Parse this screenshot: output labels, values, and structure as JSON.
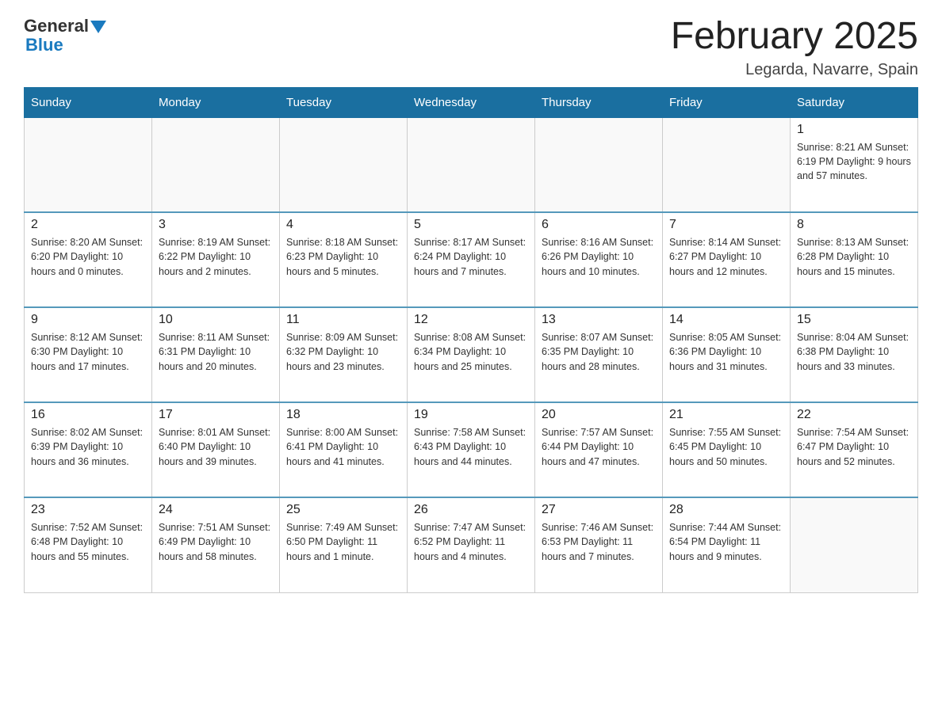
{
  "header": {
    "logo_general": "General",
    "logo_blue": "Blue",
    "title": "February 2025",
    "location": "Legarda, Navarre, Spain"
  },
  "weekdays": [
    "Sunday",
    "Monday",
    "Tuesday",
    "Wednesday",
    "Thursday",
    "Friday",
    "Saturday"
  ],
  "weeks": [
    [
      {
        "day": "",
        "info": ""
      },
      {
        "day": "",
        "info": ""
      },
      {
        "day": "",
        "info": ""
      },
      {
        "day": "",
        "info": ""
      },
      {
        "day": "",
        "info": ""
      },
      {
        "day": "",
        "info": ""
      },
      {
        "day": "1",
        "info": "Sunrise: 8:21 AM\nSunset: 6:19 PM\nDaylight: 9 hours and 57 minutes."
      }
    ],
    [
      {
        "day": "2",
        "info": "Sunrise: 8:20 AM\nSunset: 6:20 PM\nDaylight: 10 hours and 0 minutes."
      },
      {
        "day": "3",
        "info": "Sunrise: 8:19 AM\nSunset: 6:22 PM\nDaylight: 10 hours and 2 minutes."
      },
      {
        "day": "4",
        "info": "Sunrise: 8:18 AM\nSunset: 6:23 PM\nDaylight: 10 hours and 5 minutes."
      },
      {
        "day": "5",
        "info": "Sunrise: 8:17 AM\nSunset: 6:24 PM\nDaylight: 10 hours and 7 minutes."
      },
      {
        "day": "6",
        "info": "Sunrise: 8:16 AM\nSunset: 6:26 PM\nDaylight: 10 hours and 10 minutes."
      },
      {
        "day": "7",
        "info": "Sunrise: 8:14 AM\nSunset: 6:27 PM\nDaylight: 10 hours and 12 minutes."
      },
      {
        "day": "8",
        "info": "Sunrise: 8:13 AM\nSunset: 6:28 PM\nDaylight: 10 hours and 15 minutes."
      }
    ],
    [
      {
        "day": "9",
        "info": "Sunrise: 8:12 AM\nSunset: 6:30 PM\nDaylight: 10 hours and 17 minutes."
      },
      {
        "day": "10",
        "info": "Sunrise: 8:11 AM\nSunset: 6:31 PM\nDaylight: 10 hours and 20 minutes."
      },
      {
        "day": "11",
        "info": "Sunrise: 8:09 AM\nSunset: 6:32 PM\nDaylight: 10 hours and 23 minutes."
      },
      {
        "day": "12",
        "info": "Sunrise: 8:08 AM\nSunset: 6:34 PM\nDaylight: 10 hours and 25 minutes."
      },
      {
        "day": "13",
        "info": "Sunrise: 8:07 AM\nSunset: 6:35 PM\nDaylight: 10 hours and 28 minutes."
      },
      {
        "day": "14",
        "info": "Sunrise: 8:05 AM\nSunset: 6:36 PM\nDaylight: 10 hours and 31 minutes."
      },
      {
        "day": "15",
        "info": "Sunrise: 8:04 AM\nSunset: 6:38 PM\nDaylight: 10 hours and 33 minutes."
      }
    ],
    [
      {
        "day": "16",
        "info": "Sunrise: 8:02 AM\nSunset: 6:39 PM\nDaylight: 10 hours and 36 minutes."
      },
      {
        "day": "17",
        "info": "Sunrise: 8:01 AM\nSunset: 6:40 PM\nDaylight: 10 hours and 39 minutes."
      },
      {
        "day": "18",
        "info": "Sunrise: 8:00 AM\nSunset: 6:41 PM\nDaylight: 10 hours and 41 minutes."
      },
      {
        "day": "19",
        "info": "Sunrise: 7:58 AM\nSunset: 6:43 PM\nDaylight: 10 hours and 44 minutes."
      },
      {
        "day": "20",
        "info": "Sunrise: 7:57 AM\nSunset: 6:44 PM\nDaylight: 10 hours and 47 minutes."
      },
      {
        "day": "21",
        "info": "Sunrise: 7:55 AM\nSunset: 6:45 PM\nDaylight: 10 hours and 50 minutes."
      },
      {
        "day": "22",
        "info": "Sunrise: 7:54 AM\nSunset: 6:47 PM\nDaylight: 10 hours and 52 minutes."
      }
    ],
    [
      {
        "day": "23",
        "info": "Sunrise: 7:52 AM\nSunset: 6:48 PM\nDaylight: 10 hours and 55 minutes."
      },
      {
        "day": "24",
        "info": "Sunrise: 7:51 AM\nSunset: 6:49 PM\nDaylight: 10 hours and 58 minutes."
      },
      {
        "day": "25",
        "info": "Sunrise: 7:49 AM\nSunset: 6:50 PM\nDaylight: 11 hours and 1 minute."
      },
      {
        "day": "26",
        "info": "Sunrise: 7:47 AM\nSunset: 6:52 PM\nDaylight: 11 hours and 4 minutes."
      },
      {
        "day": "27",
        "info": "Sunrise: 7:46 AM\nSunset: 6:53 PM\nDaylight: 11 hours and 7 minutes."
      },
      {
        "day": "28",
        "info": "Sunrise: 7:44 AM\nSunset: 6:54 PM\nDaylight: 11 hours and 9 minutes."
      },
      {
        "day": "",
        "info": ""
      }
    ]
  ]
}
